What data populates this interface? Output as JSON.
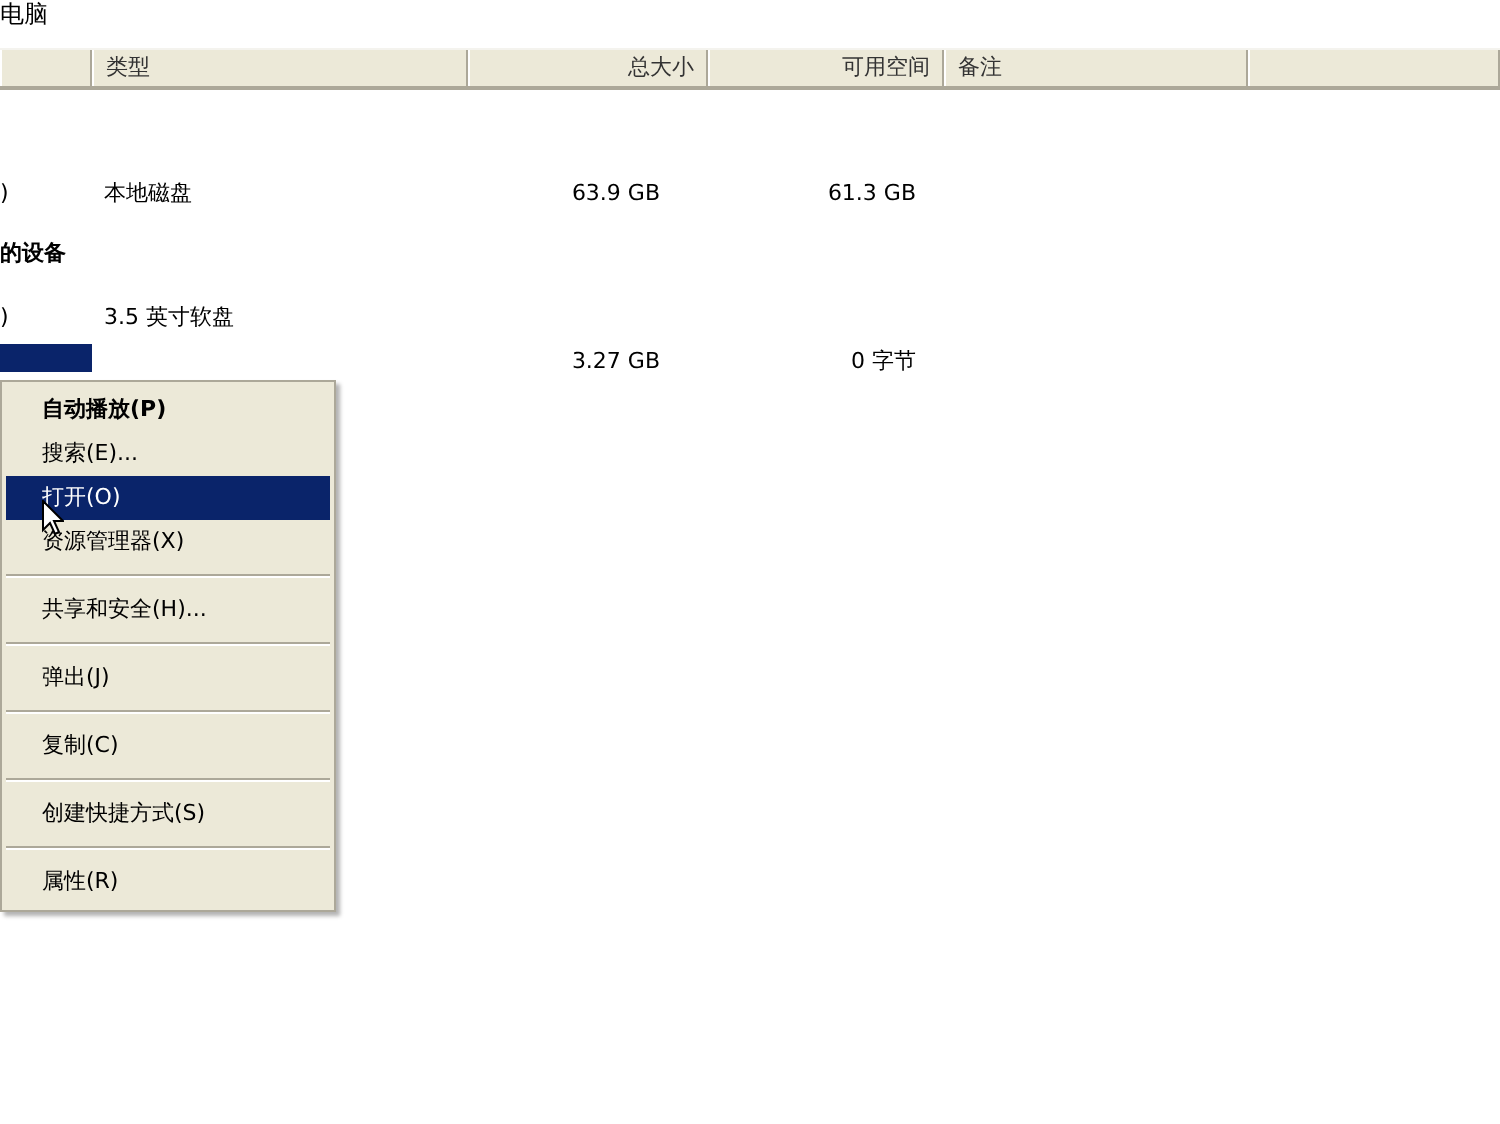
{
  "window": {
    "title": "电脑"
  },
  "table": {
    "columns": [
      {},
      {
        "label": "类型"
      },
      {
        "label": "总大小"
      },
      {
        "label": "可用空间"
      },
      {
        "label": "备注"
      },
      {}
    ],
    "rows": [
      {
        "kind": "blank"
      },
      {
        "kind": "item",
        "selected": false,
        "name": ")",
        "type": "本地磁盘",
        "total": "63.9 GB",
        "free": "61.3 GB"
      },
      {
        "kind": "group",
        "name": "的设备"
      },
      {
        "kind": "item",
        "selected": false,
        "name": ")",
        "type": "3.5 英寸软盘"
      },
      {
        "kind": "item",
        "selected": true,
        "total": "3.27 GB",
        "free": "0 字节"
      }
    ]
  },
  "context_menu": {
    "items": [
      {
        "label": "自动播放(P)",
        "default": true,
        "selected": false,
        "separator_before": false
      },
      {
        "label": "搜索(E)...",
        "default": false,
        "selected": false,
        "separator_before": false
      },
      {
        "label": "打开(O)",
        "default": false,
        "selected": true,
        "separator_before": false
      },
      {
        "label": "资源管理器(X)",
        "default": false,
        "selected": false,
        "separator_before": false
      },
      {
        "label": "共享和安全(H)...",
        "default": false,
        "selected": false,
        "separator_before": true
      },
      {
        "label": "弹出(J)",
        "default": false,
        "selected": false,
        "separator_before": true
      },
      {
        "label": "复制(C)",
        "default": false,
        "selected": false,
        "separator_before": true
      },
      {
        "label": "创建快捷方式(S)",
        "default": false,
        "selected": false,
        "separator_before": true
      },
      {
        "label": "属性(R)",
        "default": false,
        "selected": false,
        "separator_before": true
      }
    ]
  }
}
